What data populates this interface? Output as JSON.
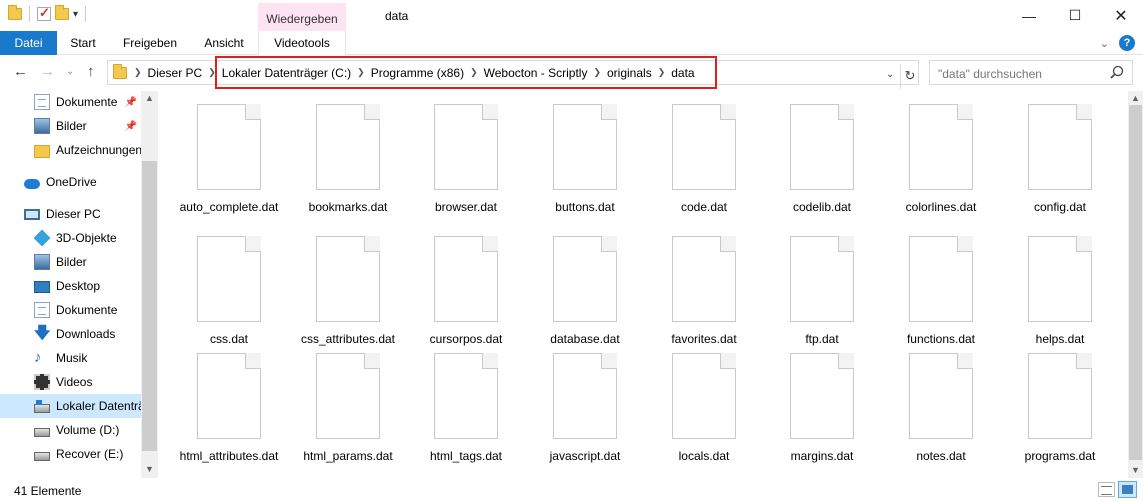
{
  "window": {
    "title": "data",
    "context_tab": "Wiedergeben",
    "minimize": "—",
    "maximize": "☐",
    "close": "✕"
  },
  "ribbon": {
    "tabs": [
      "Datei",
      "Start",
      "Freigeben",
      "Ansicht",
      "Videotools"
    ],
    "active_tab_color": "#1979ca"
  },
  "nav": {
    "back": "←",
    "forward": "→",
    "recent": "⌄",
    "up": "↑",
    "address_dropdown": "⌄",
    "refresh": "↻"
  },
  "address": {
    "crumbs": [
      "Dieser PC",
      "Lokaler Datenträger (C:)",
      "Programme (x86)",
      "Webocton - Scriptly",
      "originals",
      "data"
    ],
    "highlight_color": "#e02020"
  },
  "search": {
    "placeholder": "\"data\" durchsuchen"
  },
  "sidebar": {
    "items": [
      {
        "label": "Dokumente",
        "icon": "document-icon",
        "pinned": true
      },
      {
        "label": "Bilder",
        "icon": "pictures-icon",
        "pinned": true
      },
      {
        "label": "Aufzeichnungen",
        "icon": "folder-icon",
        "pinned": false
      },
      {
        "label": "OneDrive",
        "icon": "onedrive-icon",
        "pinned": false
      },
      {
        "label": "Dieser PC",
        "icon": "computer-icon",
        "pinned": false
      },
      {
        "label": "3D-Objekte",
        "icon": "3d-objects-icon",
        "pinned": false
      },
      {
        "label": "Bilder",
        "icon": "pictures-icon",
        "pinned": false
      },
      {
        "label": "Desktop",
        "icon": "desktop-icon",
        "pinned": false
      },
      {
        "label": "Dokumente",
        "icon": "document-icon",
        "pinned": false
      },
      {
        "label": "Downloads",
        "icon": "downloads-icon",
        "pinned": false
      },
      {
        "label": "Musik",
        "icon": "music-icon",
        "pinned": false
      },
      {
        "label": "Videos",
        "icon": "videos-icon",
        "pinned": false
      },
      {
        "label": "Lokaler Datenträ",
        "icon": "windows-drive-icon",
        "pinned": false,
        "selected": true
      },
      {
        "label": "Volume (D:)",
        "icon": "drive-icon",
        "pinned": false
      },
      {
        "label": "Recover (E:)",
        "icon": "drive-icon",
        "pinned": false
      }
    ]
  },
  "files": [
    "auto_complete.dat",
    "bookmarks.dat",
    "browser.dat",
    "buttons.dat",
    "code.dat",
    "codelib.dat",
    "colorlines.dat",
    "config.dat",
    "css.dat",
    "css_attributes.dat",
    "cursorpos.dat",
    "database.dat",
    "favorites.dat",
    "ftp.dat",
    "functions.dat",
    "helps.dat",
    "html_attributes.dat",
    "html_params.dat",
    "html_tags.dat",
    "javascript.dat",
    "locals.dat",
    "margins.dat",
    "notes.dat",
    "programs.dat"
  ],
  "status": {
    "count": "41 Elemente"
  }
}
